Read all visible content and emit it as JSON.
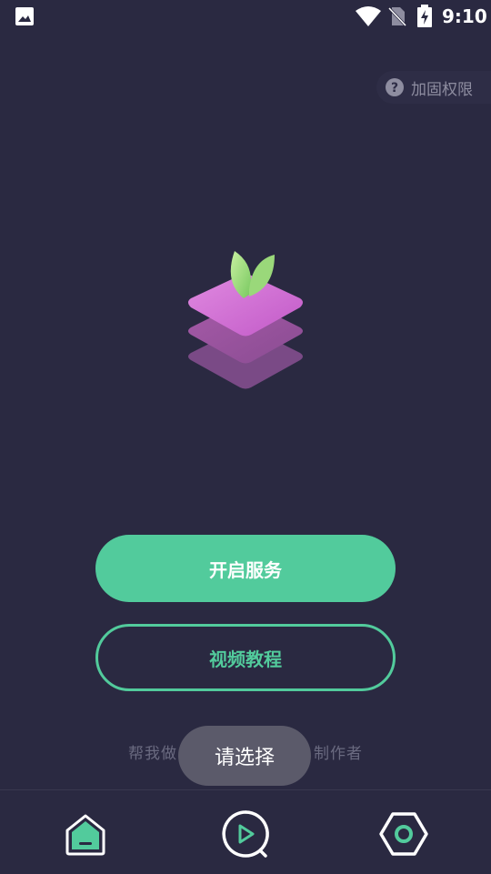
{
  "status_bar": {
    "time": "9:10",
    "icons": [
      "gallery-icon",
      "wifi-icon",
      "no-sim-icon",
      "battery-charging-icon"
    ]
  },
  "top_action": {
    "label": "加固权限",
    "icon": "help-circle-icon"
  },
  "logo": {
    "icon": "layered-stack-leaf-logo"
  },
  "buttons": {
    "start_service": "开启服务",
    "video_tutorial": "视频教程"
  },
  "footer": {
    "credit_left": "帮我做",
    "credit_right": "制作者"
  },
  "toast": {
    "message": "请选择"
  },
  "bottom_nav": {
    "items": [
      {
        "icon": "home-icon",
        "active": true
      },
      {
        "icon": "video-play-icon",
        "active": false
      },
      {
        "icon": "settings-hexagon-icon",
        "active": false
      }
    ]
  },
  "colors": {
    "background": "#2a2941",
    "accent": "#52cb9c",
    "muted_text": "#8e8da0",
    "toast_bg": "#5b5a6a"
  }
}
